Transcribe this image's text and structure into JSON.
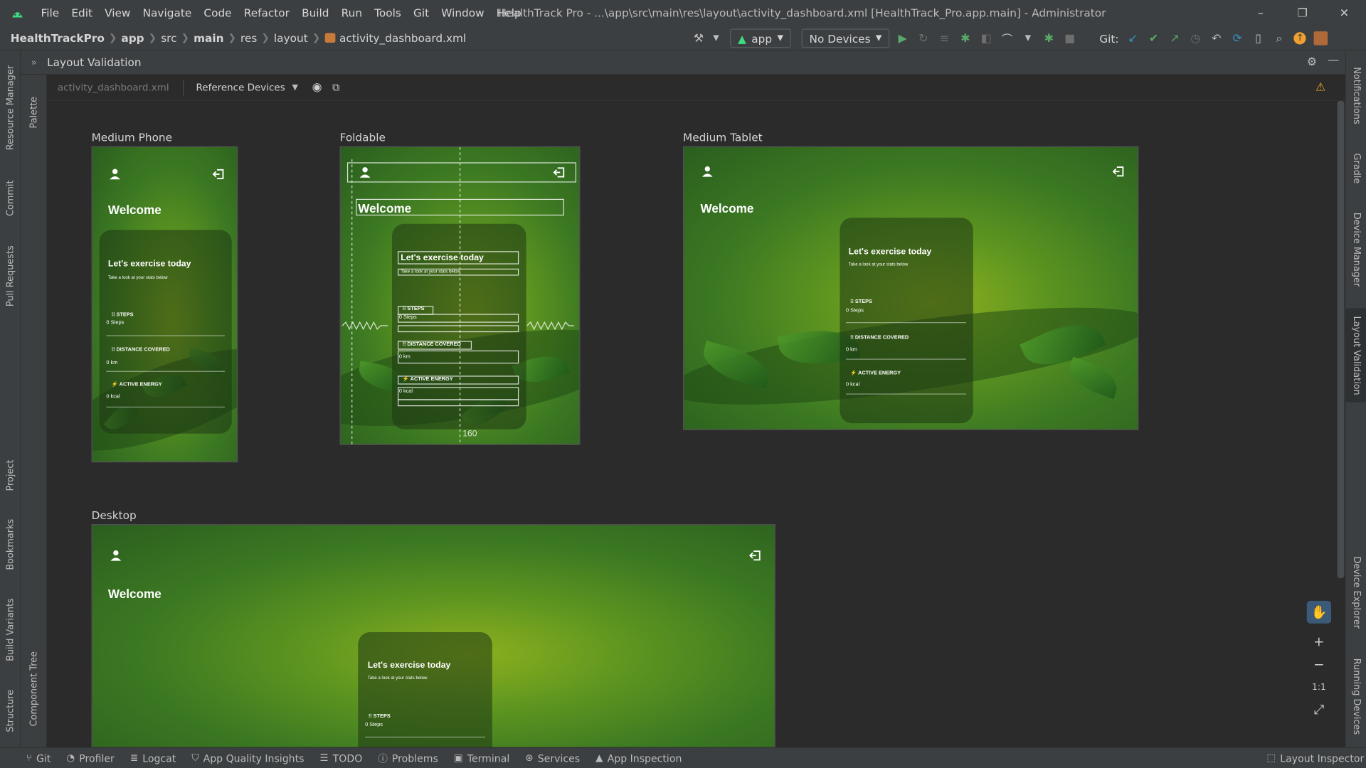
{
  "window": {
    "menu": [
      "File",
      "Edit",
      "View",
      "Navigate",
      "Code",
      "Refactor",
      "Build",
      "Run",
      "Tools",
      "Git",
      "Window",
      "Help"
    ],
    "title": "HealthTrack Pro - ...\\app\\src\\main\\res\\layout\\activity_dashboard.xml [HealthTrack_Pro.app.main] - Administrator",
    "controls": {
      "minimize": "–",
      "restore": "❐",
      "close": "✕"
    }
  },
  "breadcrumb": {
    "items": [
      "HealthTrackPro",
      "app",
      "src",
      "main",
      "res",
      "layout"
    ],
    "file": "activity_dashboard.xml"
  },
  "toolbar": {
    "run_config": "app",
    "device": "No Devices",
    "git_label": "Git:"
  },
  "left_tabs": [
    "Resource Manager",
    "Commit",
    "Pull Requests",
    "Project",
    "Bookmarks",
    "Build Variants",
    "Structure"
  ],
  "palette_tabs": [
    "Palette",
    "Component Tree"
  ],
  "right_tabs": [
    "Notifications",
    "Gradle",
    "Device Manager",
    "Layout Validation",
    "Device Explorer",
    "Running Devices"
  ],
  "panel": {
    "title": "Layout Validation",
    "file_label": "activity_dashboard.xml",
    "devices_dropdown": "Reference Devices"
  },
  "devices": [
    {
      "label": "Medium Phone"
    },
    {
      "label": "Foldable"
    },
    {
      "label": "Medium Tablet"
    },
    {
      "label": "Desktop"
    }
  ],
  "screen": {
    "welcome": "Welcome",
    "card_title": "Let's exercise today",
    "card_subtitle": "Take a look at your stats below",
    "stats": [
      {
        "name": "STEPS",
        "value": "0 Steps"
      },
      {
        "name": "DISTANCE COVERED",
        "value": "0 km"
      },
      {
        "name": "ACTIVE ENERGY",
        "value": "0 kcal"
      }
    ],
    "foldable_dim": "160"
  },
  "zoom": {
    "in": "+",
    "out": "−",
    "actual": "1:1",
    "fit": "⤢"
  },
  "bottom_tabs": [
    "Git",
    "Profiler",
    "Logcat",
    "App Quality Insights",
    "TODO",
    "Problems",
    "Terminal",
    "Services",
    "App Inspection"
  ],
  "bottom_right": "Layout Inspector",
  "colors": {
    "accent": "#3592c4",
    "background": "#2b2b2b",
    "chrome": "#3c3f41",
    "green_dark": "#2a5e1f",
    "green_light": "#8db01e"
  }
}
